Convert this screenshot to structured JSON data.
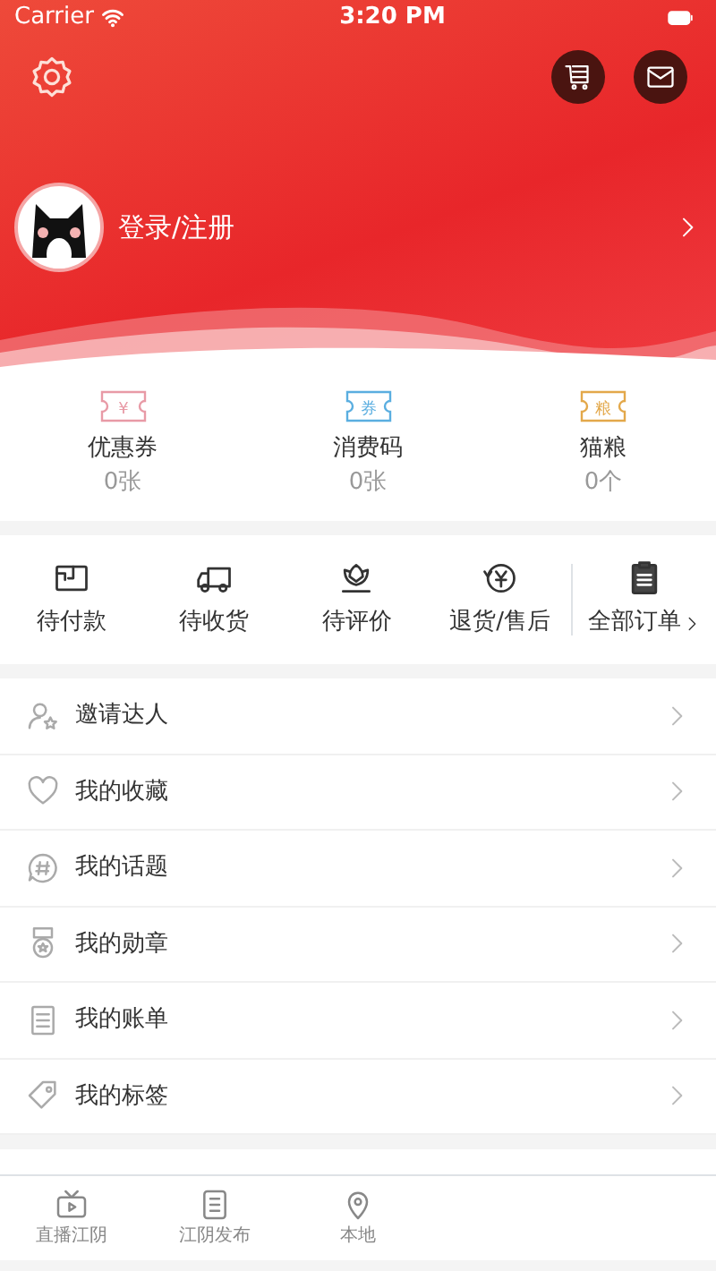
{
  "status_bar": {
    "carrier": "Carrier",
    "time": "3:20 PM"
  },
  "profile": {
    "login": "登录/注册"
  },
  "assets": [
    {
      "label": "优惠券",
      "count": "0张",
      "color": "#e89aa6",
      "glyph": "¥"
    },
    {
      "label": "消费码",
      "count": "0张",
      "color": "#5aaee0",
      "glyph": "券"
    },
    {
      "label": "猫粮",
      "count": "0个",
      "color": "#e3a84a",
      "glyph": "粮"
    }
  ],
  "orders": [
    {
      "kind": "pay",
      "label": "待付款"
    },
    {
      "kind": "ship",
      "label": "待收货"
    },
    {
      "kind": "review",
      "label": "待评价"
    },
    {
      "kind": "refund",
      "label": "退货/售后"
    }
  ],
  "all_orders": {
    "label": "全部订单"
  },
  "menu": [
    {
      "kind": "invite",
      "label": "邀请达人"
    },
    {
      "kind": "favorite",
      "label": "我的收藏"
    },
    {
      "kind": "topic",
      "label": "我的话题"
    },
    {
      "kind": "medal",
      "label": "我的勋章"
    },
    {
      "kind": "bill",
      "label": "我的账单"
    },
    {
      "kind": "tag",
      "label": "我的标签"
    }
  ],
  "tab_bar": [
    {
      "kind": "live",
      "label": "直播江阴",
      "selected": false
    },
    {
      "kind": "news",
      "label": "江阴发布",
      "selected": false
    },
    {
      "kind": "local",
      "label": "本地",
      "selected": false
    }
  ]
}
